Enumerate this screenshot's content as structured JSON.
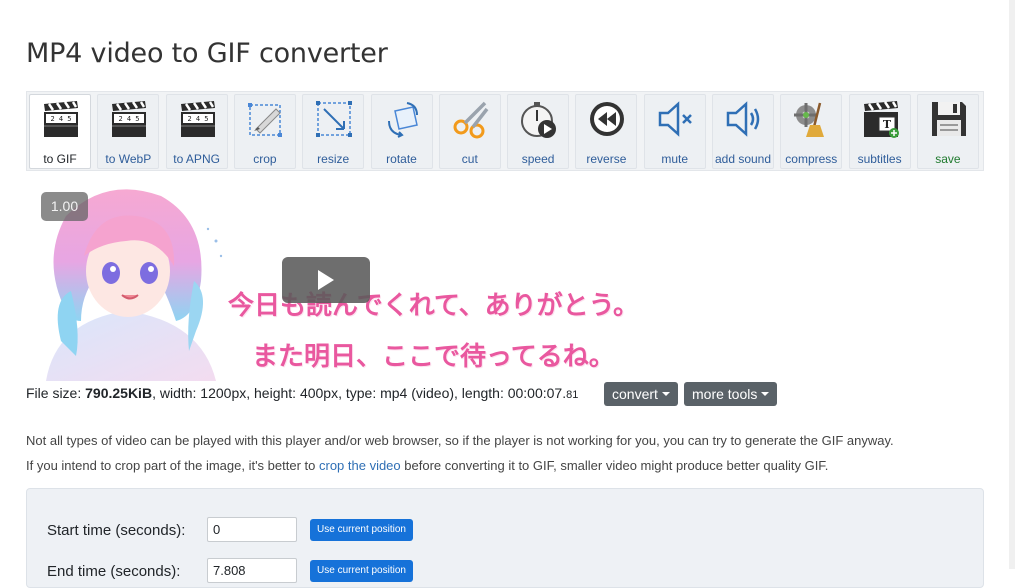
{
  "page": {
    "title": "MP4 video to GIF converter"
  },
  "toolbar": {
    "items": [
      {
        "label": "to GIF",
        "icon": "clapperboard-icon",
        "active": true
      },
      {
        "label": "to WebP",
        "icon": "clapperboard-icon"
      },
      {
        "label": "to APNG",
        "icon": "clapperboard-icon"
      },
      {
        "label": "crop",
        "icon": "crop-icon"
      },
      {
        "label": "resize",
        "icon": "resize-icon"
      },
      {
        "label": "rotate",
        "icon": "rotate-icon"
      },
      {
        "label": "cut",
        "icon": "scissors-icon"
      },
      {
        "label": "speed",
        "icon": "stopwatch-icon"
      },
      {
        "label": "reverse",
        "icon": "reverse-icon"
      },
      {
        "label": "mute",
        "icon": "mute-icon"
      },
      {
        "label": "add sound",
        "icon": "speaker-icon"
      },
      {
        "label": "compress",
        "icon": "broom-icon"
      },
      {
        "label": "subtitles",
        "icon": "subtitles-icon"
      },
      {
        "label": "save",
        "icon": "floppy-disk-icon"
      }
    ],
    "clapper_text": "2 4 5"
  },
  "player": {
    "speed": "1.00",
    "subtitle_line1": "今日も読んでくれて、ありがとう。",
    "subtitle_line2": "また明日、ここで待ってるね。"
  },
  "file_info": {
    "prefix": "File size: ",
    "size": "790.25KiB",
    "details": ", width: 1200px, height: 400px, type: mp4 (video), length: 00:00:07.",
    "length_ms": "81"
  },
  "buttons": {
    "convert": "convert",
    "more_tools": "more tools"
  },
  "notes": {
    "line1": "Not all types of video can be played with this player and/or web browser, so if the player is not working for you, you can try to generate the GIF anyway.",
    "line2_before": "If you intend to crop part of the image, it's better to ",
    "line2_link": "crop the video",
    "line2_after": " before converting it to GIF, smaller video might produce better quality GIF."
  },
  "form": {
    "start_label": "Start time (seconds):",
    "start_value": "0",
    "end_label": "End time (seconds):",
    "end_value": "7.808",
    "use_position": "Use current position"
  },
  "colors": {
    "accent": "#1672d9",
    "subtitle": "#e9589f",
    "link": "#2f6fb5",
    "save": "#1f7a2e"
  }
}
